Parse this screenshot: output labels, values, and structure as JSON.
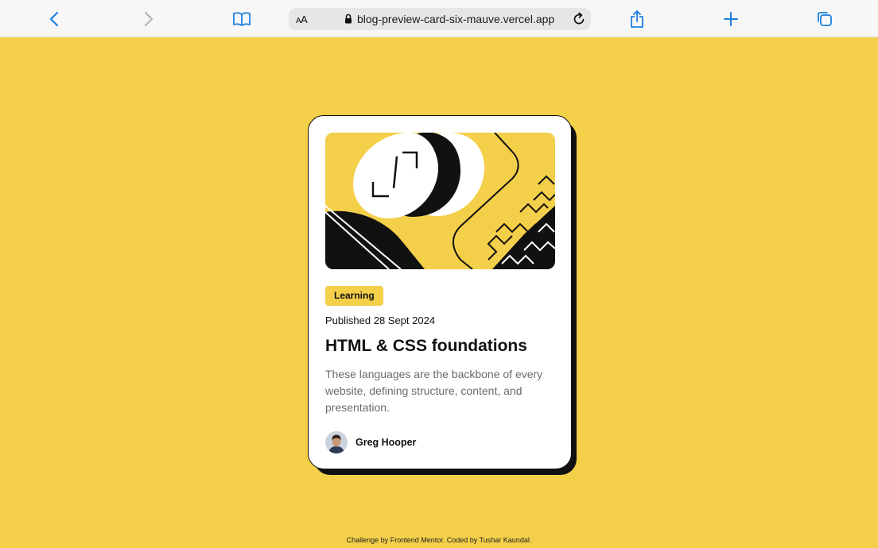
{
  "browser": {
    "text_size_small": "A",
    "text_size_big": "A",
    "url": "blog-preview-card-six-mauve.vercel.app",
    "accent_color": "#1E7FE0",
    "disabled_color": "#B5B5B5",
    "icons": [
      "back-icon",
      "forward-icon",
      "bookmarks-icon",
      "lock-icon",
      "reload-icon",
      "share-icon",
      "new-tab-icon",
      "tabs-icon"
    ]
  },
  "page": {
    "background_color": "#F4CF4A"
  },
  "card": {
    "tag": "Learning",
    "published": "Published 28 Sept 2024",
    "title": "HTML & CSS foundations",
    "description": "These languages are the backbone of every website, defining structure, content, and presentation.",
    "author": "Greg Hooper"
  },
  "footer": {
    "prefix": "Challenge by",
    "challenge_link": "Frontend Mentor",
    "middle": ". Coded by",
    "author_link": "Tushar Kaundal",
    "suffix": "."
  }
}
